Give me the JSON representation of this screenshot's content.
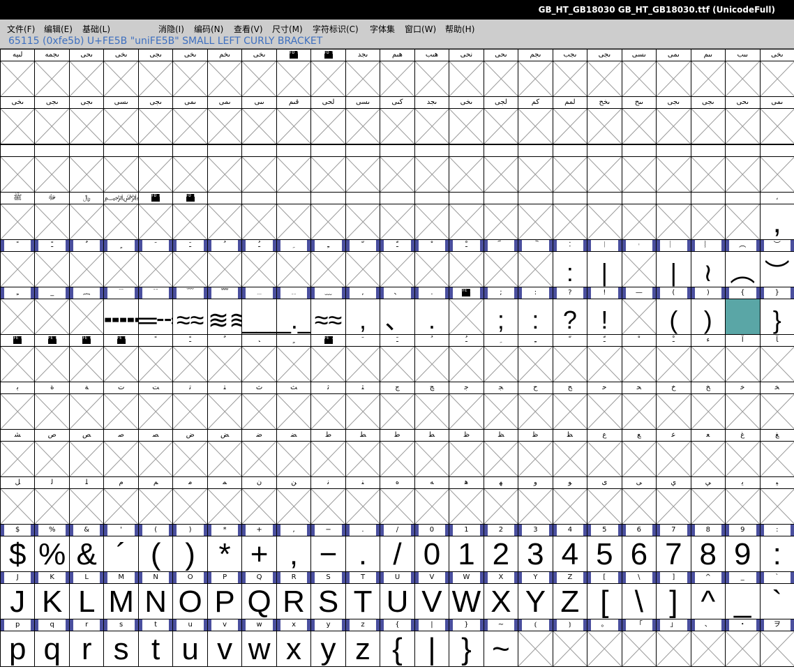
{
  "window": {
    "title": "GB_HT_GB18030  GB_HT_GB18030.ttf (UnicodeFull)"
  },
  "menu": [
    {
      "label": "文件(F)"
    },
    {
      "label": "编辑(E)"
    },
    {
      "label": "基础(L)"
    },
    {
      "label": "消隐(I)"
    },
    {
      "label": "编码(N)"
    },
    {
      "label": "查看(V)"
    },
    {
      "label": "尺寸(M)"
    },
    {
      "label": "字符标识(C)"
    },
    {
      "label": "字体集"
    },
    {
      "label": "窗口(W)"
    },
    {
      "label": "帮助(H)"
    }
  ],
  "info": {
    "text": "65115 (0xfe5b) U+FE5B \"uniFE5B\" SMALL LEFT CURLY BRACKET"
  },
  "grid": {
    "columns": 23,
    "rows": [
      {
        "labels": [
          "لىيە",
          "ىجمە",
          "ىحى",
          "ىخى",
          "ىجى",
          "ىخى",
          "ىخم",
          "ىخى",
          "FD90",
          "FD91",
          "ىجد",
          "ھىم",
          "ھىب",
          "نحى",
          "ىحى",
          "ىجم",
          "ىجب",
          "ىجى",
          "ىسى",
          "ىمى",
          "ىىم",
          "ىىب",
          "ىخى"
        ],
        "glyphs": []
      },
      {
        "labels": [
          "ىخى",
          "ىجى",
          "ىجى",
          "ىسى",
          "ىجى",
          "ىمى",
          "ىمى",
          "ىىى",
          "قىم",
          "لحى",
          "ىسى",
          "كىى",
          "ىجد",
          "ىخى",
          "لجى",
          "كم",
          "لمم",
          "ىخح",
          "ىىح",
          "ىجى",
          "ىجى",
          "ىحى",
          "ىمى",
          "ىخى"
        ],
        "glyphs": []
      },
      {
        "labels": [],
        "glyphs": []
      },
      {
        "labels": [
          "ﷺ",
          "ﷻ",
          "﷼",
          "﷽",
          "FDFE",
          "FDFF",
          "",
          "",
          "",
          "",
          "",
          "",
          "",
          "",
          "",
          "",
          "",
          "",
          "",
          "",
          "",
          "",
          "،"
        ],
        "glyphs": [
          "",
          "",
          "",
          "",
          "",
          "",
          "",
          "",
          "",
          "",
          "",
          "",
          "",
          "",
          "",
          "",
          "",
          "",
          "",
          "",
          "",
          "",
          ","
        ]
      },
      {
        "labels": [
          "ﹰ",
          "ﹱ",
          "ﹲ",
          "ﹴ",
          "ﹶ",
          "ﹷ",
          "ﹸ",
          "ﹹ",
          "ﹺ",
          "ﹻ",
          "ﹼ",
          "ﹽ",
          "ﹾ",
          "ﹿ",
          "︠",
          "︡",
          "︰",
          "︱",
          "︲",
          "︳",
          "︴",
          "︵",
          "︶"
        ],
        "glyphs": [
          "",
          "",
          "",
          "",
          "",
          "",
          "",
          "",
          "",
          "",
          "",
          "",
          "",
          "",
          "",
          "",
          ":",
          "|",
          "",
          "|",
          "≀",
          "︵",
          "︶"
        ]
      },
      {
        "labels": [
          "ـِ",
          "_",
          "︷",
          "﹉",
          "﹊",
          "﹋",
          "﹌",
          "﹍",
          "﹎",
          "﹏",
          ",",
          "、",
          ".",
          "FE53",
          ";",
          ":",
          "?",
          "!",
          "—",
          "(",
          ")",
          "{",
          "}"
        ],
        "glyphs": [
          "",
          "",
          "",
          "╍╍╍",
          "═╌═",
          "≈≈",
          "≋≋",
          "___",
          "_._",
          "≈≈",
          ",",
          "、",
          ".",
          "",
          ";",
          ":",
          "?",
          "!",
          "",
          "(",
          ")",
          "",
          "}"
        ]
      },
      {
        "labels": [
          "FE6C",
          "FE6D",
          "FE6E",
          "FE6F",
          "ﹰ",
          "ﹱ",
          "ﹲ",
          "ﹳ",
          "ﹴ",
          "FE75",
          "ﹶ",
          "ﹷ",
          "ﹸ",
          "ﹹ",
          "ﹺ",
          "ﹻ",
          "ﹼ",
          "ﹽ",
          "ﹾ",
          "ﹿ",
          "ﺀ",
          "ﺁ",
          "ﺂ"
        ],
        "glyphs": []
      },
      {
        "labels": [
          "ﺑ",
          "ﺓ",
          "ﺔ",
          "ﺕ",
          "ﺖ",
          "ﺗ",
          "ﺘ",
          "ﺙ",
          "ﺚ",
          "ﺛ",
          "ﺜ",
          "ﺝ",
          "ﺞ",
          "ﺟ",
          "ﺠ",
          "ﺡ",
          "ﺢ",
          "ﺣ",
          "ﺤ",
          "ﺥ",
          "ﺦ",
          "ﺧ",
          "ﺨ"
        ],
        "glyphs": []
      },
      {
        "labels": [
          "ﺸ",
          "ﺹ",
          "ﺺ",
          "ﺻ",
          "ﺼ",
          "ﺽ",
          "ﺾ",
          "ﺿ",
          "ﻀ",
          "ﻁ",
          "ﻂ",
          "ﻃ",
          "ﻄ",
          "ﻅ",
          "ﻆ",
          "ﻇ",
          "ﻈ",
          "ﻉ",
          "ﻊ",
          "ﻋ",
          "ﻌ",
          "ﻍ",
          "ﻎ"
        ],
        "glyphs": []
      },
      {
        "labels": [
          "ﻞ",
          "ﻟ",
          "ﻠ",
          "ﻡ",
          "ﻢ",
          "ﻣ",
          "ﻤ",
          "ﻥ",
          "ﻦ",
          "ﻧ",
          "ﻨ",
          "ﻩ",
          "ﻪ",
          "ﻫ",
          "ﻬ",
          "ﻭ",
          "ﻮ",
          "ﻯ",
          "ﻰ",
          "ﻱ",
          "ﻲ",
          "ﻳ",
          "ﻴ"
        ],
        "glyphs": []
      },
      {
        "labels": [
          "$",
          "%",
          "&",
          "'",
          "(",
          ")",
          "*",
          "+",
          ",",
          "−",
          ".",
          "/",
          "0",
          "1",
          "2",
          "3",
          "4",
          "5",
          "6",
          "7",
          "8",
          "9",
          ":"
        ],
        "glyphs": [
          "$",
          "%",
          "&",
          "´",
          "(",
          ")",
          "*",
          "+",
          ",",
          "−",
          ".",
          "/",
          "0",
          "1",
          "2",
          "3",
          "4",
          "5",
          "6",
          "7",
          "8",
          "9",
          ":"
        ]
      },
      {
        "labels": [
          "J",
          "K",
          "L",
          "M",
          "N",
          "O",
          "P",
          "Q",
          "R",
          "S",
          "T",
          "U",
          "V",
          "W",
          "X",
          "Y",
          "Z",
          "[",
          "\\",
          "]",
          "^",
          "_",
          "`"
        ],
        "glyphs": [
          "J",
          "K",
          "L",
          "M",
          "N",
          "O",
          "P",
          "Q",
          "R",
          "S",
          "T",
          "U",
          "V",
          "W",
          "X",
          "Y",
          "Z",
          "[",
          "\\",
          "]",
          "^",
          "_",
          "`"
        ]
      },
      {
        "labels": [
          "p",
          "q",
          "r",
          "s",
          "t",
          "u",
          "v",
          "w",
          "x",
          "y",
          "z",
          "{",
          "|",
          "}",
          "~",
          "⦅",
          "⦆",
          "。",
          "「",
          "」",
          "、",
          "・",
          "ヲ"
        ],
        "glyphs": [
          "p",
          "q",
          "r",
          "s",
          "t",
          "u",
          "v",
          "w",
          "x",
          "y",
          "z",
          "{",
          "|",
          "}",
          "~",
          "",
          "",
          "",
          "",
          "",
          "",
          "",
          ""
        ]
      }
    ]
  }
}
